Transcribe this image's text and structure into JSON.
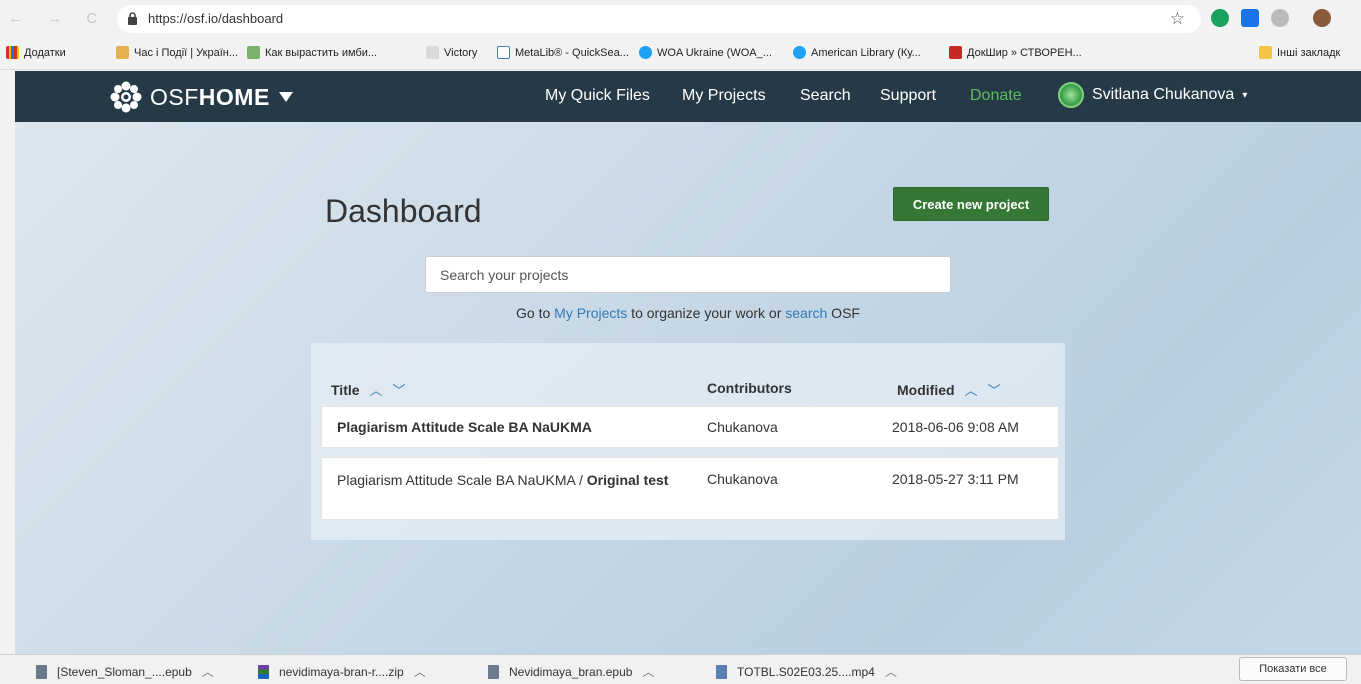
{
  "browser": {
    "nav_glyphs": "← → C",
    "url": "https://osf.io/dashboard",
    "bookmarks": [
      "Додатки",
      "Час і Події | Україн...",
      "Как вырастить имби...",
      "Victory",
      "MetaLib® - QuickSea...",
      "WOA Ukraine (WOA_...",
      "American Library (Ку...",
      "ДокШир » СТВОРЕН...",
      "Інші закладк"
    ]
  },
  "osf_nav": {
    "logo_prefix": "OSF",
    "logo_bold": "HOME",
    "links": [
      "My Quick Files",
      "My Projects",
      "Search",
      "Support",
      "Donate"
    ],
    "user": "Svitlana Chukanova"
  },
  "dashboard": {
    "title": "Dashboard",
    "create_button": "Create new project",
    "search_placeholder": "Search your projects",
    "goto": {
      "prefix": "Go to ",
      "link1": "My Projects",
      "middle": " to organize your work or ",
      "link2": "search",
      "suffix": " OSF"
    },
    "table": {
      "headers": [
        "Title",
        "Contributors",
        "Modified"
      ],
      "rows": [
        {
          "title_plain": "",
          "title_bold": "Plagiarism Attitude Scale BA NaUKMA",
          "contributors": "Chukanova",
          "modified": "2018-06-06 9:08 AM"
        },
        {
          "title_plain": "Plagiarism Attitude Scale BA NaUKMA / ",
          "title_bold": "Original test",
          "contributors": "Chukanova",
          "modified": "2018-05-27 3:11 PM"
        }
      ]
    }
  },
  "downloads": {
    "items": [
      "[Steven_Sloman_....epub",
      "nevidimaya-bran-r....zip",
      "Nevidimaya_bran.epub",
      "TOTBL.S02E03.25....mp4"
    ],
    "show_all": "Показати все"
  },
  "colors": {
    "nav_bg": "#263947",
    "create_button": "#357735",
    "link": "#337ab7",
    "donate": "#5bbf5b"
  }
}
